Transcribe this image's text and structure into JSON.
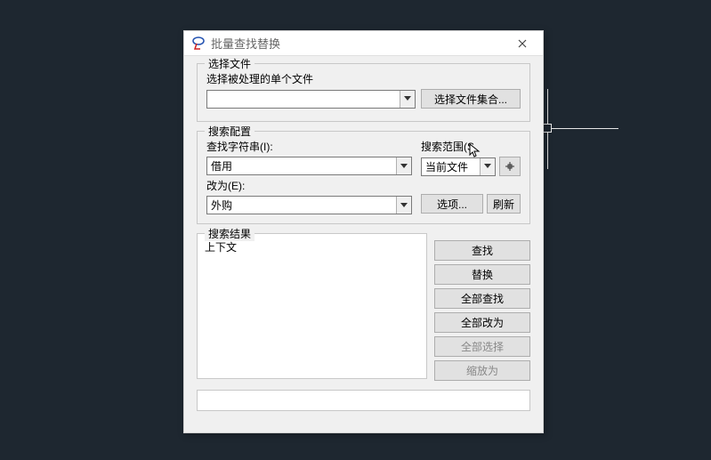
{
  "dialog": {
    "title": "批量查找替换",
    "close": "×"
  },
  "fileSelect": {
    "legend": "选择文件",
    "label": "选择被处理的单个文件",
    "combo_value": "",
    "button": "选择文件集合..."
  },
  "searchConfig": {
    "legend": "搜索配置",
    "findLabel": "查找字符串(I):",
    "findValue": "借用",
    "replaceLabel": "改为(E):",
    "replaceValue": "外购",
    "scopeLabel": "搜索范围(S",
    "scopeValue": "当前文件",
    "optionsBtn": "选项...",
    "refreshBtn": "刷新"
  },
  "results": {
    "legend": "搜索结果",
    "contextLabel": "上下文"
  },
  "actions": {
    "find": "查找",
    "replace": "替换",
    "findAll": "全部查找",
    "replaceAll": "全部改为",
    "selectAll": "全部选择",
    "zoomTo": "缩放为"
  }
}
